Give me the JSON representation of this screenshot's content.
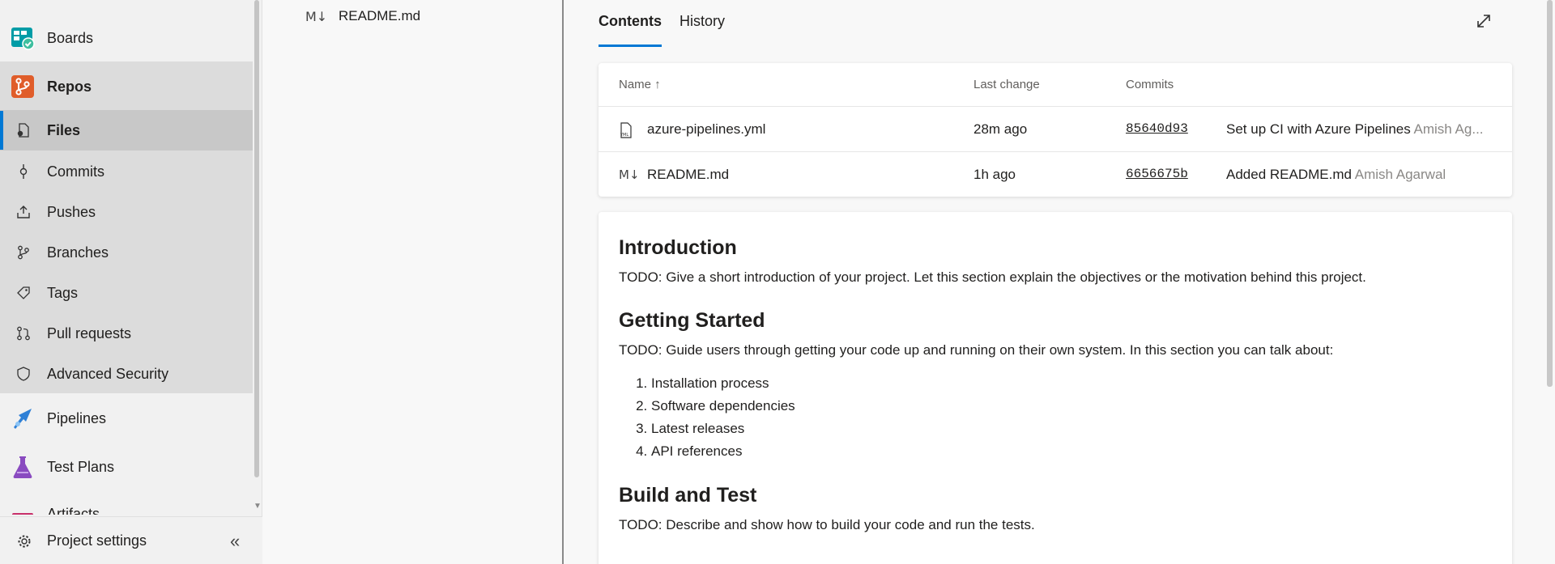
{
  "sidebar": {
    "boards": "Boards",
    "repos": "Repos",
    "files": "Files",
    "commits": "Commits",
    "pushes": "Pushes",
    "branches": "Branches",
    "tags": "Tags",
    "pull_requests": "Pull requests",
    "advanced_security": "Advanced Security",
    "pipelines": "Pipelines",
    "test_plans": "Test Plans",
    "artifacts": "Artifacts",
    "project_settings": "Project settings",
    "collapse_icon": "«"
  },
  "tree": {
    "file_icon": "M↓",
    "item": "README.md"
  },
  "tabs": {
    "contents": "Contents",
    "history": "History"
  },
  "files_table": {
    "headers": {
      "name": "Name ↑",
      "last_change": "Last change",
      "commits": "Commits"
    },
    "rows": [
      {
        "icon": "YML",
        "name": "azure-pipelines.yml",
        "last_change": "28m ago",
        "hash": "85640d93",
        "message": "Set up CI with Azure Pipelines",
        "author": "Amish Ag..."
      },
      {
        "icon": "M↓",
        "name": "README.md",
        "last_change": "1h ago",
        "hash": "6656675b",
        "message": "Added README.md",
        "author": "Amish Agarwal"
      }
    ]
  },
  "readme": {
    "intro_title": "Introduction",
    "intro_text": "TODO: Give a short introduction of your project. Let this section explain the objectives or the motivation behind this project.",
    "started_title": "Getting Started",
    "started_text": "TODO: Guide users through getting your code up and running on their own system. In this section you can talk about:",
    "steps": [
      "Installation process",
      "Software dependencies",
      "Latest releases",
      "API references"
    ],
    "build_title": "Build and Test",
    "build_text": "TODO: Describe and show how to build your code and run the tests."
  },
  "colors": {
    "accent": "#0078d4",
    "repos_brand": "#e05d2a",
    "boards_brand": "#009ca6",
    "pipelines_brand": "#2f80d6",
    "testplans_brand": "#8a4bc0",
    "artifacts_brand": "#c8306a"
  }
}
